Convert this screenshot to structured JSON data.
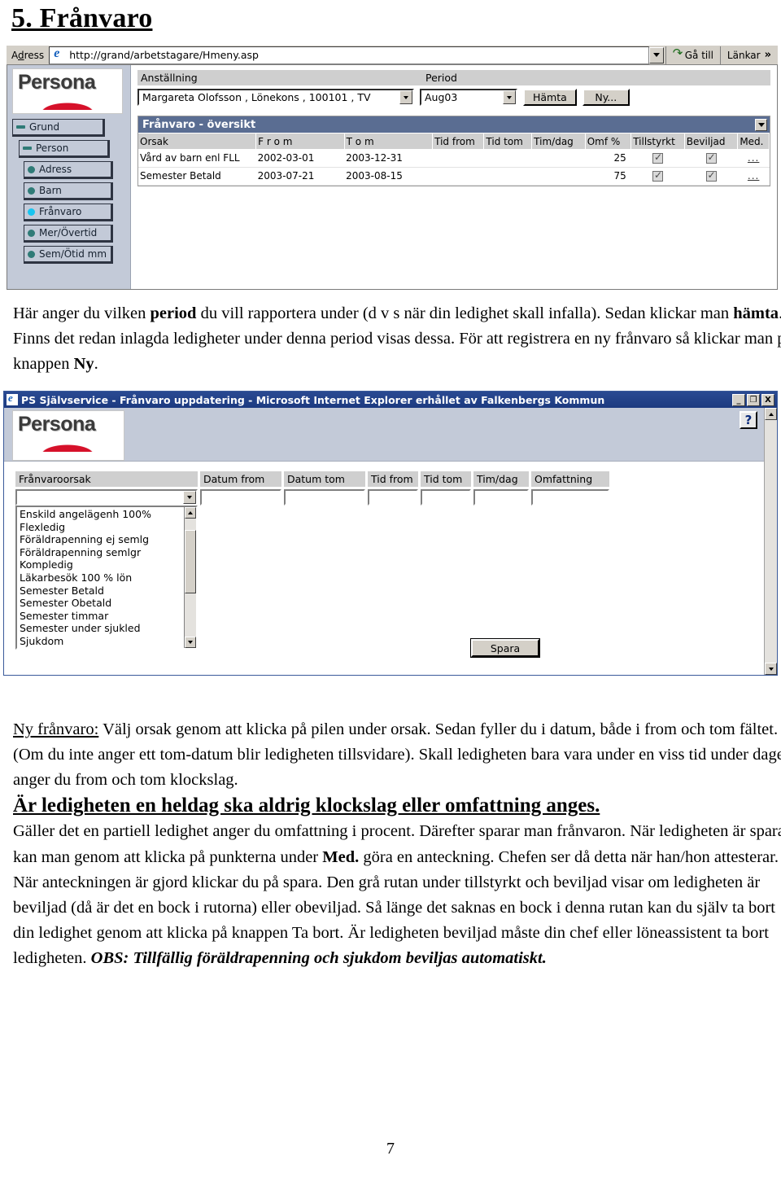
{
  "document": {
    "heading": "5. Frånvaro",
    "page_number": "7"
  },
  "browser1": {
    "address_bar": {
      "label": "Adress",
      "url": "http://grand/arbetstagare/Hmeny.asp",
      "go_button": "Gå till",
      "links_button": "Länkar",
      "more_chevron": "»",
      "dropdown_icon": "chevron-down-icon",
      "page_icon": "ie-page-icon"
    },
    "sidebar": {
      "logo_text": "Persona",
      "items": [
        {
          "label": "Grund",
          "marker": "dash",
          "level": 0,
          "active": false
        },
        {
          "label": "Person",
          "marker": "dash",
          "level": 1,
          "active": false
        },
        {
          "label": "Adress",
          "marker": "bullet",
          "level": 2,
          "active": false
        },
        {
          "label": "Barn",
          "marker": "bullet",
          "level": 2,
          "active": false
        },
        {
          "label": "Frånvaro",
          "marker": "bullet",
          "level": 2,
          "active": true
        },
        {
          "label": "Mer/Övertid",
          "marker": "bullet",
          "level": 2,
          "active": false
        },
        {
          "label": "Sem/Ötid mm",
          "marker": "bullet",
          "level": 2,
          "active": false
        }
      ]
    },
    "form": {
      "anstallning_label": "Anställning",
      "anstallning_value": "Margareta Olofsson , Lönekons , 100101 , TV",
      "period_label": "Period",
      "period_value": "Aug03",
      "hamta_button": "Hämta",
      "ny_button": "Ny..."
    },
    "overview": {
      "title": "Frånvaro - översikt",
      "collapse_icon": "chevron-down-icon",
      "columns": [
        "Orsak",
        "F r o m",
        "T o m",
        "Tid from",
        "Tid tom",
        "Tim/dag",
        "Omf %",
        "Tillstyrkt",
        "Beviljad",
        "Med."
      ],
      "rows": [
        {
          "orsak": "Vård av barn enl FLL",
          "from": "2002-03-01",
          "tom": "2003-12-31",
          "tid_from": "",
          "tid_tom": "",
          "tim_dag": "",
          "omf": "25",
          "tillstyrkt": true,
          "beviljad": true,
          "med": "..."
        },
        {
          "orsak": "Semester Betald",
          "from": "2003-07-21",
          "tom": "2003-08-15",
          "tid_from": "",
          "tid_tom": "",
          "tim_dag": "",
          "omf": "75",
          "tillstyrkt": true,
          "beviljad": true,
          "med": "..."
        }
      ]
    }
  },
  "paragraph1": {
    "part1": "Här anger du vilken ",
    "bold1": "period",
    "part2": " du vill rapportera under (d v s när din ledighet skall infalla). Sedan klickar man ",
    "bold2": "hämta",
    "part3": ". Finns det redan inlagda ledigheter under denna period visas dessa. För att registrera en ny frånvaro så klickar man på knappen ",
    "bold3": "Ny",
    "part4": "."
  },
  "browser2": {
    "title": "PS Självservice - Frånvaro uppdatering - Microsoft Internet Explorer erhållet av Falkenbergs Kommun",
    "window_buttons": {
      "minimize": "_",
      "maximize": "❐",
      "close": "X"
    },
    "logo_text": "Persona",
    "help_button": "?",
    "form": {
      "columns": [
        "Frånvaroorsak",
        "Datum from",
        "Datum tom",
        "Tid from",
        "Tid tom",
        "Tim/dag",
        "Omfattning"
      ],
      "values": {
        "franvaroorsak": "",
        "datum_from": "",
        "datum_tom": "",
        "tid_from": "",
        "tid_tom": "",
        "tim_dag": "",
        "omfattning": ""
      },
      "save_button": "Spara"
    },
    "dropdown_options": [
      "Enskild angelägenh 100%",
      "Flexledig",
      "Föräldrapenning ej semlg",
      "Föräldrapenning semlgr",
      "Kompledig",
      "Läkarbesök 100 % lön",
      "Semester Betald",
      "Semester Obetald",
      "Semester timmar",
      "Semester under sjukled",
      "Sjukdom"
    ]
  },
  "paragraph2": {
    "lead_underlined": "Ny frånvaro:",
    "text1": " Välj orsak genom att klicka på pilen under orsak. Sedan fyller du i datum, både i from och tom fältet. (Om du inte anger ett tom-datum blir ledigheten tillsvidare). Skall ledigheten bara vara under en viss tid under dagen anger du from och tom klockslag.",
    "emphasis_line": "Är ledigheten en heldag ska aldrig klockslag eller omfattning anges.",
    "text2": "Gäller det en partiell ledighet anger du omfattning i procent. Därefter sparar man frånvaron.",
    "text3a": "När ledigheten är sparad kan man genom att klicka på punkterna under ",
    "bold_med": "Med.",
    "text3b": " göra en anteckning. Chefen ser då detta när han/hon attesterar. När anteckningen är gjord klickar du på spara.  Den grå rutan under tillstyrkt och beviljad visar om ledigheten är beviljad (då är det en bock i rutorna) eller obeviljad. Så länge det saknas en bock i denna rutan kan du själv ta bort din ledighet genom att klicka på knappen Ta bort. Är ledigheten beviljad måste din chef eller löneassistent ta bort ledigheten. ",
    "obs": "OBS: Tillfällig föräldrapenning och sjukdom beviljas automatiskt."
  },
  "colors": {
    "nav_background": "#c3cad8",
    "nav_bullet": "#2f7b77",
    "nav_bullet_active": "#18c4ef",
    "panel_title": "#5a6d92",
    "logo_red": "#d6112a",
    "titlebar_blue": "#1c3a80"
  }
}
